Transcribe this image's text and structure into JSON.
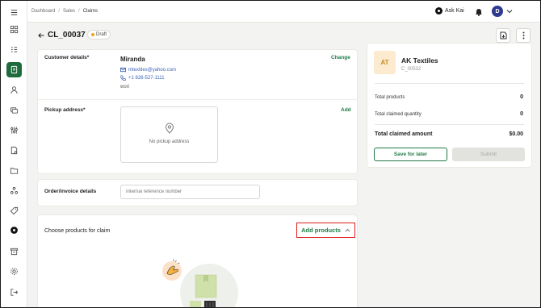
{
  "breadcrumb": {
    "items": [
      "Dashboard",
      "Sales"
    ],
    "current": "Claims"
  },
  "topbar": {
    "ask_label": "Ask Kai",
    "avatar_initial": "D"
  },
  "header": {
    "claim_id": "CL_00037",
    "status": "Draft"
  },
  "customer": {
    "label": "Customer details*",
    "name": "Miranda",
    "email": "mtextiles@yahoo.com",
    "phone": "+1 826-527-1111",
    "note": "wori",
    "change_label": "Change"
  },
  "pickup": {
    "label": "Pickup address*",
    "add_label": "Add",
    "empty_text": "No pickup address"
  },
  "order": {
    "label": "Order/invoice details",
    "placeholder": "Internal reference number"
  },
  "products": {
    "label": "Choose products for claim",
    "add_label": "Add products"
  },
  "vendor": {
    "initials": "AT",
    "name": "AK Textiles",
    "code": "C_00532"
  },
  "summary": {
    "total_products_label": "Total products",
    "total_products_value": "0",
    "total_qty_label": "Total claimed quantity",
    "total_qty_value": "0",
    "total_amount_label": "Total claimed amount",
    "total_amount_value": "$0.00"
  },
  "actions": {
    "save_label": "Save for later",
    "submit_label": "Submit"
  },
  "colors": {
    "brand_green": "#1f6b3c",
    "link_green": "#1f7a44",
    "highlight_red": "#e02020",
    "draft_dot": "#f0a020"
  },
  "icons": {
    "sidebar": [
      "menu-icon",
      "dashboard-icon",
      "list-icon",
      "claims-icon",
      "user-icon",
      "coins-icon",
      "sliders-icon",
      "cart-icon",
      "folder-icon",
      "network-icon",
      "tag-icon",
      "kai-icon",
      "store-icon",
      "settings-icon",
      "logout-icon"
    ]
  }
}
